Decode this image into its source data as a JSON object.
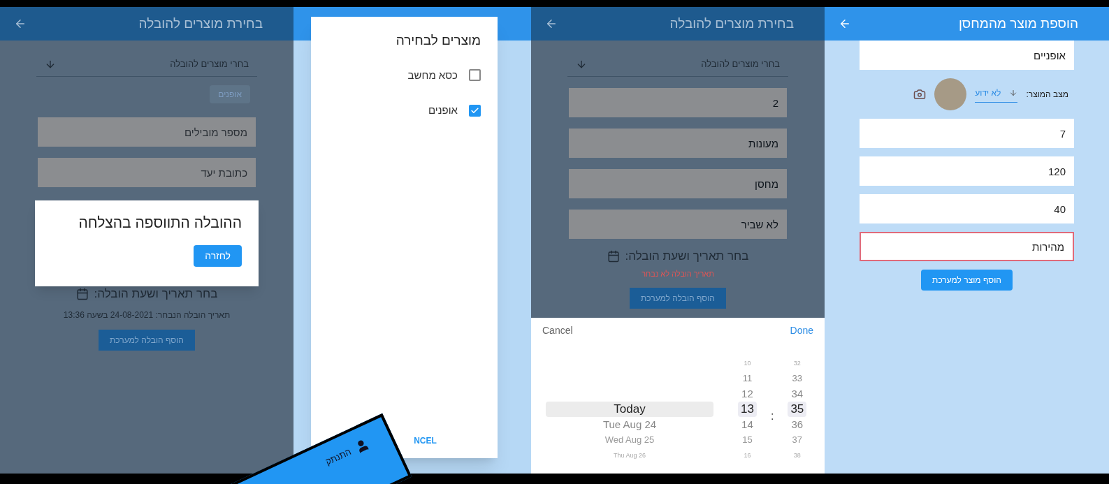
{
  "delivery_success": {
    "title": "בחירת מוצרים להובלה",
    "product_select": "בחרי מוצרים להובלה",
    "chips": [
      "אופנים"
    ],
    "fields": [
      {
        "placeholder": "מספר מובילים"
      },
      {
        "placeholder": "כתובת יעד"
      }
    ],
    "date_label": "בחר תאריך ושעת הובלה:",
    "chosen_date": "תאריך הובלה הנבחר: 24-08-2021 בשעה 13:36",
    "submit": "הוסף הובלה למערכת",
    "dialog": {
      "message": "ההובלה התווספה בהצלחה",
      "button": "לחזרה"
    }
  },
  "product_picker": {
    "title": "מוצרים לבחירה",
    "items": [
      {
        "label": "כסא מחשב",
        "checked": false
      },
      {
        "label": "אופנים",
        "checked": true
      }
    ],
    "cancel": "NCEL"
  },
  "delivery_date_picker": {
    "title": "בחירת מוצרים להובלה",
    "product_select": "בחרי מוצרים להובלה",
    "fields": [
      {
        "value": "2"
      },
      {
        "value": "מעונות"
      },
      {
        "value": "מחסן"
      },
      {
        "value": "לא שביר"
      }
    ],
    "date_label": "בחר תאריך ושעת הובלה:",
    "error": "תאריך הובלה לא נבחר",
    "submit": "הוסף הובלה למערכת",
    "picker": {
      "cancel": "Cancel",
      "done": "Done",
      "separator": ":",
      "days": [
        {
          "label": "Today",
          "selected": true
        },
        {
          "label": "Tue Aug 24",
          "selected": false
        },
        {
          "label": "Wed Aug 25",
          "selected": false
        },
        {
          "label": "Thu Aug 26",
          "selected": false
        }
      ],
      "hours": [
        {
          "label": "10",
          "selected": false
        },
        {
          "label": "11",
          "selected": false
        },
        {
          "label": "12",
          "selected": false
        },
        {
          "label": "13",
          "selected": true
        },
        {
          "label": "14",
          "selected": false
        },
        {
          "label": "15",
          "selected": false
        },
        {
          "label": "16",
          "selected": false
        }
      ],
      "minutes": [
        {
          "label": "32",
          "selected": false
        },
        {
          "label": "33",
          "selected": false
        },
        {
          "label": "34",
          "selected": false
        },
        {
          "label": "35",
          "selected": true
        },
        {
          "label": "36",
          "selected": false
        },
        {
          "label": "37",
          "selected": false
        },
        {
          "label": "38",
          "selected": false
        }
      ]
    }
  },
  "add_product": {
    "title": "הוספת מוצר מהמחסן",
    "name": {
      "value": "אופניים",
      "error": false
    },
    "condition_label": "מצב המוצר:",
    "condition": "לא ידוע",
    "fields": [
      {
        "value": "7",
        "error": false
      },
      {
        "value": "120",
        "error": false
      },
      {
        "value": "40",
        "error": false
      },
      {
        "value": "מהירות",
        "error": true
      }
    ],
    "submit": "הוסף מוצר למערכת"
  },
  "logout_banner": {
    "label": "התנתק"
  }
}
